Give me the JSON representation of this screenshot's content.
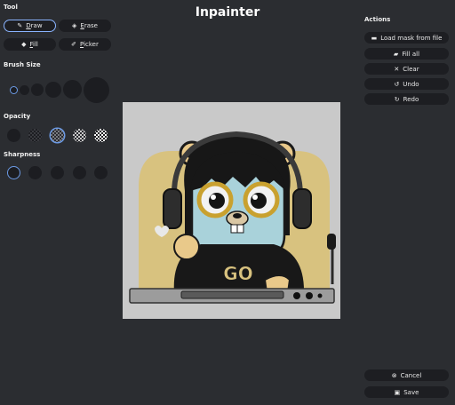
{
  "app": {
    "title": "Inpainter"
  },
  "tool": {
    "label": "Tool",
    "buttons": [
      {
        "key": "D",
        "rest": "raw",
        "icon": "pencil-icon"
      },
      {
        "key": "E",
        "rest": "rase",
        "icon": "eraser-icon"
      },
      {
        "key": "F",
        "rest": "ill",
        "icon": "paint-bucket-icon"
      },
      {
        "key": "P",
        "rest": "icker",
        "icon": "eyedropper-icon"
      }
    ],
    "selected": "Draw"
  },
  "brush_size": {
    "label": "Brush Size",
    "count": 6,
    "selected_index": 0
  },
  "opacity": {
    "label": "Opacity",
    "count": 5,
    "selected_index": 2
  },
  "sharpness": {
    "label": "Sharpness",
    "count": 5,
    "selected_index": 0
  },
  "actions": {
    "label": "Actions",
    "load_mask": "Load mask from file",
    "fill_all": "Fill all",
    "clear": "Clear",
    "undo": "Undo",
    "redo": "Redo"
  },
  "footer": {
    "cancel": "Cancel",
    "save": "Save"
  },
  "image": {
    "description_icon": "gopher-mascot-image",
    "shirt_text": "GO"
  },
  "colors": {
    "background": "#2b2d31",
    "button": "#1d1e22",
    "accent": "#6c9be6",
    "canvas": "#c9c9c9"
  }
}
